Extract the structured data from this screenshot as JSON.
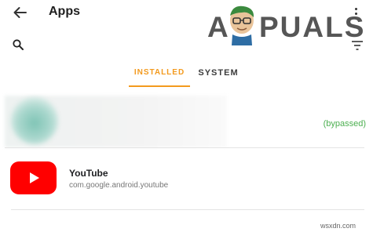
{
  "toolbar": {
    "title": "Apps",
    "back_icon": "arrow-left-icon",
    "more_icon": "more-vert-icon",
    "search_icon": "search-icon",
    "filter_icon": "filter-icon"
  },
  "logo": {
    "text_left": "A",
    "text_right": "PUALS"
  },
  "tabs": [
    {
      "label": "INSTALLED",
      "selected": true
    },
    {
      "label": "SYSTEM",
      "selected": false
    }
  ],
  "apps": [
    {
      "name": "",
      "package": "",
      "status": "(bypassed)",
      "blurred": true
    },
    {
      "name": "YouTube",
      "package": "com.google.android.youtube",
      "icon": "youtube-icon"
    }
  ],
  "watermark": "wsxdn.com",
  "colors": {
    "accent": "#f39a1e",
    "status_green": "#4caf50",
    "youtube_red": "#ff0000"
  }
}
